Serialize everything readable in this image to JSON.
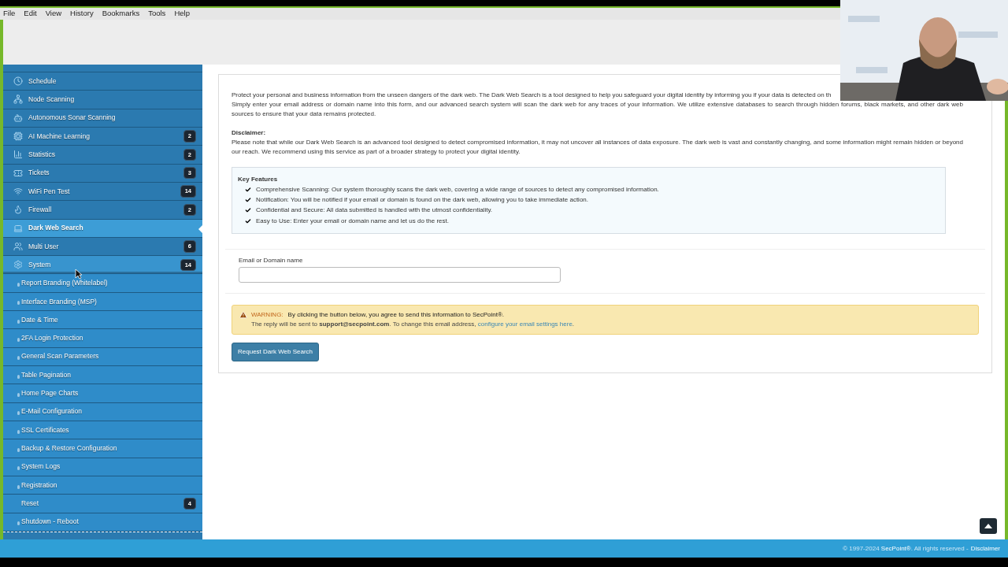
{
  "browser_menu": [
    "File",
    "Edit",
    "View",
    "History",
    "Bookmarks",
    "Tools",
    "Help"
  ],
  "sidebar": {
    "items": [
      {
        "label": "Schedule",
        "kind": "main",
        "selected": false,
        "expanded": false
      },
      {
        "label": "Node Scanning",
        "kind": "main",
        "selected": false,
        "expanded": false
      },
      {
        "label": "Autonomous Sonar Scanning",
        "kind": "main",
        "selected": false,
        "expanded": false
      },
      {
        "label": "AI Machine Learning",
        "kind": "main",
        "badge": "2",
        "selected": false,
        "expanded": false
      },
      {
        "label": "Statistics",
        "kind": "main",
        "badge": "2",
        "selected": false,
        "expanded": false
      },
      {
        "label": "Tickets",
        "kind": "main",
        "badge": "3",
        "selected": false,
        "expanded": false
      },
      {
        "label": "WiFi Pen Test",
        "kind": "main",
        "badge": "14",
        "selected": false,
        "expanded": false
      },
      {
        "label": "Firewall",
        "kind": "main",
        "badge": "2",
        "selected": false,
        "expanded": false
      },
      {
        "label": "Dark Web Search",
        "kind": "main",
        "selected": true,
        "expanded": false
      },
      {
        "label": "Multi User",
        "kind": "main",
        "badge": "6",
        "selected": false,
        "expanded": false
      },
      {
        "label": "System",
        "kind": "main",
        "badge": "14",
        "selected": false,
        "expanded": true
      },
      {
        "label": "Report Branding (Whitelabel)",
        "kind": "sub",
        "selected": false
      },
      {
        "label": "Interface Branding (MSP)",
        "kind": "sub",
        "selected": false
      },
      {
        "label": "Date & Time",
        "kind": "sub",
        "selected": false
      },
      {
        "label": "2FA Login Protection",
        "kind": "sub",
        "selected": false
      },
      {
        "label": "General Scan Parameters",
        "kind": "sub",
        "selected": false
      },
      {
        "label": "Table Pagination",
        "kind": "sub",
        "selected": false
      },
      {
        "label": "Home Page Charts",
        "kind": "sub",
        "selected": false
      },
      {
        "label": "E-Mail Configuration",
        "kind": "sub",
        "selected": false
      },
      {
        "label": "SSL Certificates",
        "kind": "sub",
        "selected": false
      },
      {
        "label": "Backup & Restore Configuration",
        "kind": "sub",
        "selected": false
      },
      {
        "label": "System Logs",
        "kind": "sub",
        "selected": false
      },
      {
        "label": "Registration",
        "kind": "sub",
        "selected": false
      },
      {
        "label": "Reset",
        "kind": "plain",
        "badge": "4",
        "selected": false
      },
      {
        "label": "Shutdown - Reboot",
        "kind": "sub",
        "selected": false
      }
    ]
  },
  "intro_lines": [
    "Protect your personal and business information from the unseen dangers of the dark web. The Dark Web Search is a tool designed to help you safeguard your digital identity by informing you if your data is detected on th",
    "Simply enter your email address or domain name into this form, and our advanced search system will scan the dark web for any traces of your information. We utilize extensive databases to search through hidden forums, black markets, and other dark web",
    "sources to ensure that your data remains protected."
  ],
  "disclaimer": {
    "title": "Disclaimer:",
    "lines": [
      "Please note that while our Dark Web Search is an advanced tool designed to detect compromised information, it may not uncover all instances of data exposure. The dark web is vast and constantly changing, and some information might remain hidden or beyond",
      "our reach. We recommend using this service as part of a broader strategy to protect your digital identity."
    ]
  },
  "key_features": {
    "title": "Key Features",
    "items": [
      "Comprehensive Scanning: Our system thoroughly scans the dark web, covering a wide range of sources to detect any compromised information.",
      "Notification: You will be notified if your email or domain is found on the dark web, allowing you to take immediate action.",
      "Confidential and Secure: All data submitted is handled with the utmost confidentiality.",
      "Easy to Use: Enter your email or domain name and let us do the rest."
    ]
  },
  "email_field": {
    "label": "Email or Domain name"
  },
  "warning": {
    "label": "WARNING:",
    "text": "By clicking the button below, you agree to send this information to SecPoint®.",
    "line2": "The reply will be sent to **support@secpoint.com**. To change this email address,",
    "link": "configure your email settings here",
    "line2_end": "."
  },
  "submit_button": "Request Dark Web Search",
  "footer": {
    "copyright": "© 1997-2024 **SecPoint®**. All rights reserved -",
    "link": "Disclaimer"
  }
}
